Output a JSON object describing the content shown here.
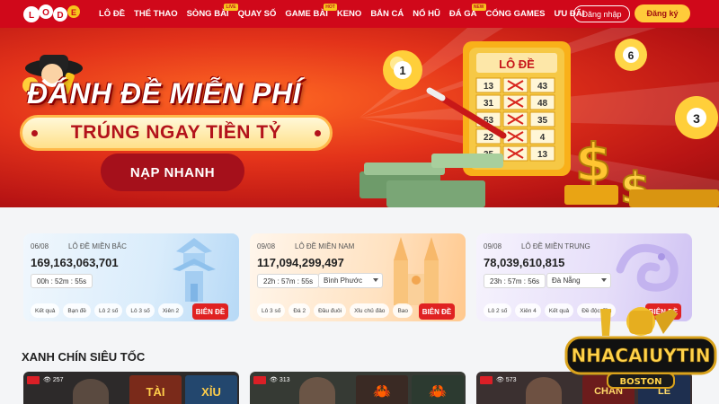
{
  "header": {
    "logo_text": "LODE",
    "nav": [
      {
        "label": "LÔ ĐỀ",
        "tag": ""
      },
      {
        "label": "THỂ THAO",
        "tag": ""
      },
      {
        "label": "SÒNG BÀI",
        "tag": "LIVE"
      },
      {
        "label": "QUAY SỐ",
        "tag": ""
      },
      {
        "label": "GAME BÀI",
        "tag": "HOT"
      },
      {
        "label": "KENO",
        "tag": ""
      },
      {
        "label": "BẮN CÁ",
        "tag": ""
      },
      {
        "label": "NỔ HŨ",
        "tag": ""
      },
      {
        "label": "ĐÁ GÀ",
        "tag": "NEW"
      },
      {
        "label": "CỔNG GAMES",
        "tag": ""
      },
      {
        "label": "ƯU ĐÃI",
        "tag": ""
      }
    ],
    "login_label": "Đăng nhập",
    "register_label": "Đăng ký"
  },
  "banner": {
    "headline": "ĐÁNH ĐỀ MIỄN PHÍ",
    "subline": "TRÚNG NGAY TIỀN TỶ",
    "cta": "NẠP NHANH",
    "ticket_title": "LÔ ĐỀ",
    "ticket_numbers": [
      "13",
      "43",
      "31",
      "48",
      "53",
      "35",
      "22",
      "4",
      "35",
      "13"
    ],
    "balls": [
      "1",
      "6",
      "3"
    ],
    "slides": 4
  },
  "cards": [
    {
      "date": "06/08",
      "name": "LÔ ĐỀ MIỀN BẮC",
      "amount": "169,163,063,701",
      "timer": "00h : 52m : 55s",
      "select": "",
      "chips": [
        "Kết quả",
        "Bạn đề",
        "Lô 2 số",
        "Lô 3 số",
        "Xiên 2"
      ],
      "button": "BIÊN ĐỀ"
    },
    {
      "date": "09/08",
      "name": "LÔ ĐỀ MIỀN NAM",
      "amount": "117,094,299,497",
      "timer": "22h : 57m : 55s",
      "select": "Bình Phước",
      "chips": [
        "Lô 3 số",
        "Đá 2",
        "Đầu đuôi",
        "Xỉu chủ đảo",
        "Bao"
      ],
      "button": "BIÊN ĐỀ"
    },
    {
      "date": "09/08",
      "name": "LÔ ĐỀ MIỀN TRUNG",
      "amount": "78,039,610,815",
      "timer": "23h : 57m : 56s",
      "select": "Đà Nẵng",
      "chips": [
        "Lô 2 số",
        "Xiên 4",
        "Kết quả",
        "Đề độc đầu"
      ],
      "button": "BIÊN ĐỀ"
    }
  ],
  "section": {
    "title": "XANH CHÍN SIÊU TỐC",
    "games": [
      {
        "viewers": "257",
        "tiles": [
          "TÀI",
          "XỈU"
        ]
      },
      {
        "viewers": "313",
        "tiles": [
          "",
          ""
        ]
      },
      {
        "viewers": "573",
        "tiles": [
          "CHẴN",
          "LẺ"
        ]
      }
    ]
  },
  "watermark": {
    "brand": "NHACAIUYTIN",
    "sub": "BOSTON"
  },
  "colors": {
    "primary": "#d0081a",
    "accent": "#ffcb3a",
    "button_red": "#e02222"
  }
}
